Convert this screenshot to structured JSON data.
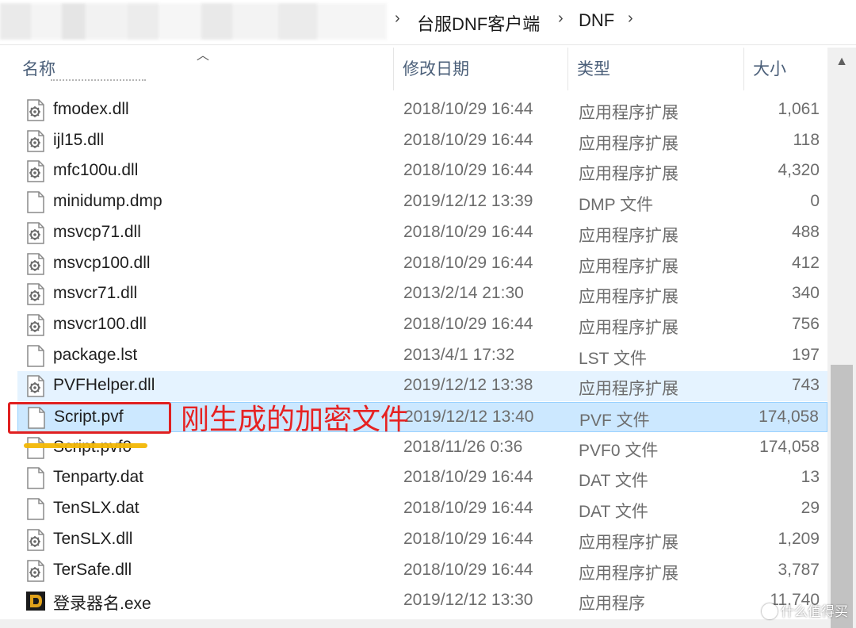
{
  "breadcrumb": {
    "items": [
      "台服DNF客户端",
      "DNF"
    ]
  },
  "columns": {
    "name": "名称",
    "date": "修改日期",
    "type": "类型",
    "size": "大小"
  },
  "files": [
    {
      "name": "fmodex.dll",
      "date": "2018/10/29 16:44",
      "type": "应用程序扩展",
      "size": "1,061",
      "icon": "dll-gear-icon"
    },
    {
      "name": "ijl15.dll",
      "date": "2018/10/29 16:44",
      "type": "应用程序扩展",
      "size": "118",
      "icon": "dll-gear-icon"
    },
    {
      "name": "mfc100u.dll",
      "date": "2018/10/29 16:44",
      "type": "应用程序扩展",
      "size": "4,320",
      "icon": "dll-gear-icon"
    },
    {
      "name": "minidump.dmp",
      "date": "2019/12/12 13:39",
      "type": "DMP 文件",
      "size": "0",
      "icon": "blank-file-icon"
    },
    {
      "name": "msvcp71.dll",
      "date": "2018/10/29 16:44",
      "type": "应用程序扩展",
      "size": "488",
      "icon": "dll-gear-icon"
    },
    {
      "name": "msvcp100.dll",
      "date": "2018/10/29 16:44",
      "type": "应用程序扩展",
      "size": "412",
      "icon": "dll-gear-icon"
    },
    {
      "name": "msvcr71.dll",
      "date": "2013/2/14 21:30",
      "type": "应用程序扩展",
      "size": "340",
      "icon": "dll-gear-icon"
    },
    {
      "name": "msvcr100.dll",
      "date": "2018/10/29 16:44",
      "type": "应用程序扩展",
      "size": "756",
      "icon": "dll-gear-icon"
    },
    {
      "name": "package.lst",
      "date": "2013/4/1 17:32",
      "type": "LST 文件",
      "size": "197",
      "icon": "blank-file-icon"
    },
    {
      "name": "PVFHelper.dll",
      "date": "2019/12/12 13:38",
      "type": "应用程序扩展",
      "size": "743",
      "icon": "dll-gear-icon"
    },
    {
      "name": "Script.pvf",
      "date": "2019/12/12 13:40",
      "type": "PVF 文件",
      "size": "174,058",
      "icon": "blank-file-icon"
    },
    {
      "name": "Script.pvf0",
      "date": "2018/11/26 0:36",
      "type": "PVF0 文件",
      "size": "174,058",
      "icon": "blank-file-icon"
    },
    {
      "name": "Tenparty.dat",
      "date": "2018/10/29 16:44",
      "type": "DAT 文件",
      "size": "13",
      "icon": "blank-file-icon"
    },
    {
      "name": "TenSLX.dat",
      "date": "2018/10/29 16:44",
      "type": "DAT 文件",
      "size": "29",
      "icon": "blank-file-icon"
    },
    {
      "name": "TenSLX.dll",
      "date": "2018/10/29 16:44",
      "type": "应用程序扩展",
      "size": "1,209",
      "icon": "dll-gear-icon"
    },
    {
      "name": "TerSafe.dll",
      "date": "2018/10/29 16:44",
      "type": "应用程序扩展",
      "size": "3,787",
      "icon": "dll-gear-icon"
    },
    {
      "name": "登录器名.exe",
      "date": "2019/12/12 13:30",
      "type": "应用程序",
      "size": "11,740",
      "icon": "dnf-app-icon"
    }
  ],
  "selected_file": "Script.pvf",
  "hovered_file": "PVFHelper.dll",
  "annotation": {
    "text": "刚生成的加密文件",
    "color": "#e62222"
  },
  "watermark": {
    "text": "什么值得买"
  },
  "colors": {
    "selection": "#cce8ff",
    "hover": "#e5f3ff",
    "header_text": "#4c607a",
    "highlight_underline": "#f2b705"
  }
}
